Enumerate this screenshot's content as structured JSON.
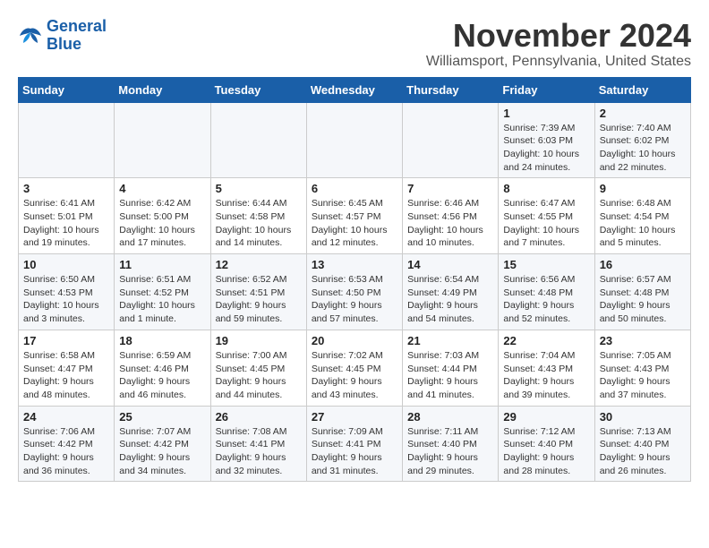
{
  "logo": {
    "line1": "General",
    "line2": "Blue"
  },
  "header": {
    "month": "November 2024",
    "location": "Williamsport, Pennsylvania, United States"
  },
  "weekdays": [
    "Sunday",
    "Monday",
    "Tuesday",
    "Wednesday",
    "Thursday",
    "Friday",
    "Saturday"
  ],
  "weeks": [
    [
      {
        "day": "",
        "info": ""
      },
      {
        "day": "",
        "info": ""
      },
      {
        "day": "",
        "info": ""
      },
      {
        "day": "",
        "info": ""
      },
      {
        "day": "",
        "info": ""
      },
      {
        "day": "1",
        "info": "Sunrise: 7:39 AM\nSunset: 6:03 PM\nDaylight: 10 hours and 24 minutes."
      },
      {
        "day": "2",
        "info": "Sunrise: 7:40 AM\nSunset: 6:02 PM\nDaylight: 10 hours and 22 minutes."
      }
    ],
    [
      {
        "day": "3",
        "info": "Sunrise: 6:41 AM\nSunset: 5:01 PM\nDaylight: 10 hours and 19 minutes."
      },
      {
        "day": "4",
        "info": "Sunrise: 6:42 AM\nSunset: 5:00 PM\nDaylight: 10 hours and 17 minutes."
      },
      {
        "day": "5",
        "info": "Sunrise: 6:44 AM\nSunset: 4:58 PM\nDaylight: 10 hours and 14 minutes."
      },
      {
        "day": "6",
        "info": "Sunrise: 6:45 AM\nSunset: 4:57 PM\nDaylight: 10 hours and 12 minutes."
      },
      {
        "day": "7",
        "info": "Sunrise: 6:46 AM\nSunset: 4:56 PM\nDaylight: 10 hours and 10 minutes."
      },
      {
        "day": "8",
        "info": "Sunrise: 6:47 AM\nSunset: 4:55 PM\nDaylight: 10 hours and 7 minutes."
      },
      {
        "day": "9",
        "info": "Sunrise: 6:48 AM\nSunset: 4:54 PM\nDaylight: 10 hours and 5 minutes."
      }
    ],
    [
      {
        "day": "10",
        "info": "Sunrise: 6:50 AM\nSunset: 4:53 PM\nDaylight: 10 hours and 3 minutes."
      },
      {
        "day": "11",
        "info": "Sunrise: 6:51 AM\nSunset: 4:52 PM\nDaylight: 10 hours and 1 minute."
      },
      {
        "day": "12",
        "info": "Sunrise: 6:52 AM\nSunset: 4:51 PM\nDaylight: 9 hours and 59 minutes."
      },
      {
        "day": "13",
        "info": "Sunrise: 6:53 AM\nSunset: 4:50 PM\nDaylight: 9 hours and 57 minutes."
      },
      {
        "day": "14",
        "info": "Sunrise: 6:54 AM\nSunset: 4:49 PM\nDaylight: 9 hours and 54 minutes."
      },
      {
        "day": "15",
        "info": "Sunrise: 6:56 AM\nSunset: 4:48 PM\nDaylight: 9 hours and 52 minutes."
      },
      {
        "day": "16",
        "info": "Sunrise: 6:57 AM\nSunset: 4:48 PM\nDaylight: 9 hours and 50 minutes."
      }
    ],
    [
      {
        "day": "17",
        "info": "Sunrise: 6:58 AM\nSunset: 4:47 PM\nDaylight: 9 hours and 48 minutes."
      },
      {
        "day": "18",
        "info": "Sunrise: 6:59 AM\nSunset: 4:46 PM\nDaylight: 9 hours and 46 minutes."
      },
      {
        "day": "19",
        "info": "Sunrise: 7:00 AM\nSunset: 4:45 PM\nDaylight: 9 hours and 44 minutes."
      },
      {
        "day": "20",
        "info": "Sunrise: 7:02 AM\nSunset: 4:45 PM\nDaylight: 9 hours and 43 minutes."
      },
      {
        "day": "21",
        "info": "Sunrise: 7:03 AM\nSunset: 4:44 PM\nDaylight: 9 hours and 41 minutes."
      },
      {
        "day": "22",
        "info": "Sunrise: 7:04 AM\nSunset: 4:43 PM\nDaylight: 9 hours and 39 minutes."
      },
      {
        "day": "23",
        "info": "Sunrise: 7:05 AM\nSunset: 4:43 PM\nDaylight: 9 hours and 37 minutes."
      }
    ],
    [
      {
        "day": "24",
        "info": "Sunrise: 7:06 AM\nSunset: 4:42 PM\nDaylight: 9 hours and 36 minutes."
      },
      {
        "day": "25",
        "info": "Sunrise: 7:07 AM\nSunset: 4:42 PM\nDaylight: 9 hours and 34 minutes."
      },
      {
        "day": "26",
        "info": "Sunrise: 7:08 AM\nSunset: 4:41 PM\nDaylight: 9 hours and 32 minutes."
      },
      {
        "day": "27",
        "info": "Sunrise: 7:09 AM\nSunset: 4:41 PM\nDaylight: 9 hours and 31 minutes."
      },
      {
        "day": "28",
        "info": "Sunrise: 7:11 AM\nSunset: 4:40 PM\nDaylight: 9 hours and 29 minutes."
      },
      {
        "day": "29",
        "info": "Sunrise: 7:12 AM\nSunset: 4:40 PM\nDaylight: 9 hours and 28 minutes."
      },
      {
        "day": "30",
        "info": "Sunrise: 7:13 AM\nSunset: 4:40 PM\nDaylight: 9 hours and 26 minutes."
      }
    ]
  ]
}
